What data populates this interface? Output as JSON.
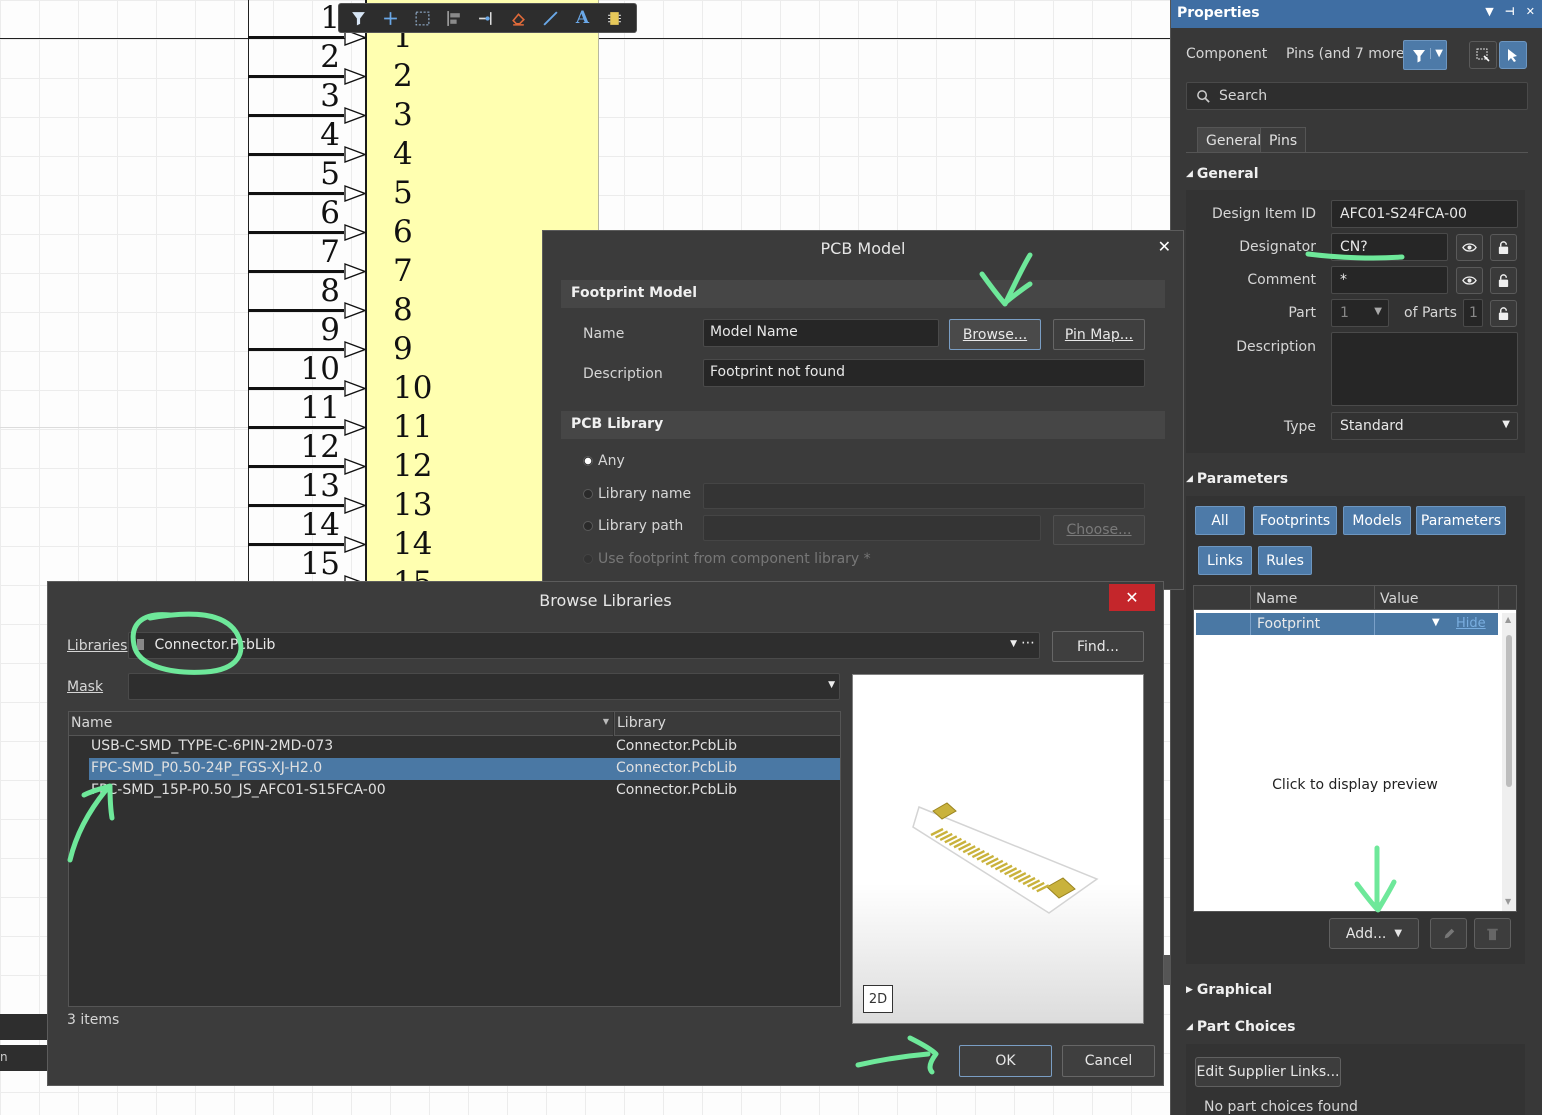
{
  "schematic": {
    "pin_numbers": [
      "1",
      "2",
      "3",
      "4",
      "5",
      "6",
      "7",
      "8",
      "9",
      "10",
      "11",
      "12",
      "13",
      "14",
      "15"
    ],
    "pin_names": [
      "1",
      "2",
      "3",
      "4",
      "5",
      "6",
      "7",
      "8",
      "9",
      "10",
      "11",
      "12",
      "13",
      "14",
      "15"
    ],
    "left_strip_text": "n"
  },
  "toolbar": {
    "icons": [
      "filter-icon",
      "cross-icon",
      "select-rect-icon",
      "align-icon",
      "pin-icon",
      "eraser-icon",
      "line-icon",
      "text-icon",
      "part-icon"
    ],
    "text_glyph": "A"
  },
  "properties": {
    "title": "Properties",
    "component_label": "Component",
    "filter_label": "Pins (and 7 more)",
    "search_placeholder": "Search",
    "tabs": [
      "General",
      "Pins"
    ],
    "general": {
      "heading": "General",
      "design_item_id_label": "Design Item ID",
      "design_item_id": "AFC01-S24FCA-00",
      "designator_label": "Designator",
      "designator": "CN?",
      "comment_label": "Comment",
      "comment": "*",
      "part_label": "Part",
      "part_value": "1",
      "of_parts_label": "of Parts",
      "of_parts_value": "1",
      "description_label": "Description",
      "description": "",
      "type_label": "Type",
      "type_value": "Standard"
    },
    "parameters": {
      "heading": "Parameters",
      "filter_buttons": [
        "All",
        "Footprints",
        "Models",
        "Parameters",
        "Links",
        "Rules"
      ],
      "columns": [
        "Name",
        "Value"
      ],
      "rows": [
        {
          "name": "Footprint",
          "value": "",
          "action": "Hide"
        }
      ],
      "preview_text": "Click to display preview",
      "add_label": "Add..."
    },
    "graphical_heading": "Graphical",
    "part_choices": {
      "heading": "Part Choices",
      "edit_button": "Edit Supplier Links...",
      "status": "No part choices found"
    }
  },
  "pcb_model": {
    "title": "PCB Model",
    "footprint_heading": "Footprint Model",
    "name_label": "Name",
    "name_value": "Model Name",
    "browse_label": "Browse...",
    "pinmap_label": "Pin Map...",
    "description_label": "Description",
    "description_value": "Footprint not found",
    "library_heading": "PCB Library",
    "radio_any": "Any",
    "radio_libname": "Library name",
    "radio_libpath": "Library path",
    "choose_label": "Choose...",
    "use_footprint": "Use footprint from component library *"
  },
  "browse": {
    "title": "Browse Libraries",
    "libraries_label": "Libraries",
    "library_value": "Connector.PcbLib",
    "find_label": "Find...",
    "mask_label": "Mask",
    "mask_value": "",
    "columns": [
      "Name",
      "Library"
    ],
    "rows": [
      {
        "name": "USB-C-SMD_TYPE-C-6PIN-2MD-073",
        "library": "Connector.PcbLib"
      },
      {
        "name": "FPC-SMD_P0.50-24P_FGS-XJ-H2.0",
        "library": "Connector.PcbLib"
      },
      {
        "name": "FPC-SMD_15P-P0.50_JS_AFC01-S15FCA-00",
        "library": "Connector.PcbLib"
      }
    ],
    "selected_index": 1,
    "item_count": "3 items",
    "view_2d_label": "2D",
    "ok_label": "OK",
    "cancel_label": "Cancel"
  },
  "colors": {
    "accent": "#4a78a4",
    "panel_title": "#3f6ea3",
    "close_red": "#c4262b",
    "annotation": "#6ee89a",
    "component_fill": "#ffffb0",
    "pad_gold": "#c9b23c"
  }
}
